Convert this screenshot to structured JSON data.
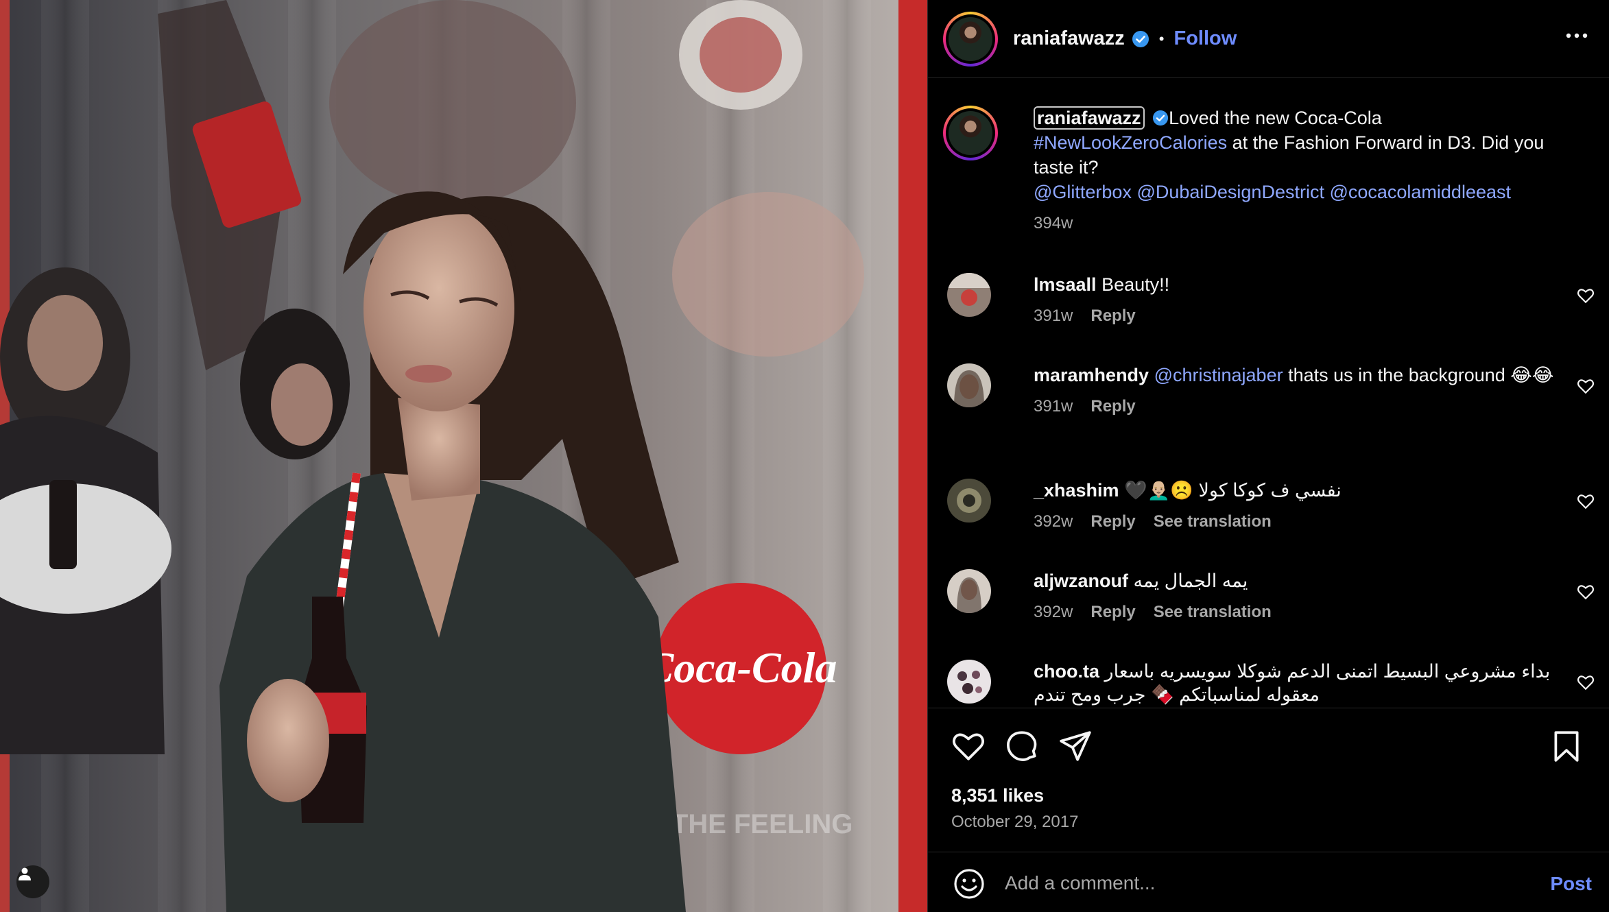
{
  "post": {
    "username": "raniafawazz",
    "follow_label": "Follow",
    "separator": "•"
  },
  "caption": {
    "username": "raniafawazz",
    "text_1": "Loved the new Coca-Cola",
    "hashtag": "#NewLookZeroCalories",
    "text_2": " at the Fashion Forward in D3. Did you taste it?",
    "mentions": "@Glitterbox @DubaiDesignDestrict @cocacolamiddleeast",
    "age": "394w"
  },
  "photo": {
    "logo_text": "Coca-Cola",
    "banner_text": "TE THE FEELING"
  },
  "comments": [
    {
      "user": "lmsaall",
      "text": "Beauty!!",
      "age": "391w",
      "reply": "Reply",
      "translate": ""
    },
    {
      "user": "maramhendy",
      "mention": "@christinajaber",
      "text": " thats us in the background 😂😂",
      "age": "391w",
      "reply": "Reply",
      "translate": ""
    },
    {
      "user": "_xhashim",
      "text": "🖤👨🏼‍🦲☹️ نفسي ف كوكا كولا",
      "age": "392w",
      "reply": "Reply",
      "translate": "See translation"
    },
    {
      "user": "aljwzanouf",
      "text": "يمه الجمال يمه",
      "age": "392w",
      "reply": "Reply",
      "translate": "See translation"
    },
    {
      "user": "choo.ta",
      "text": "بداء مشروعي البسيط اتمنى الدعم شوكلا سويسريه باسعار معقوله لمناسباتكم 🍫 جرب ومح تندم",
      "age": "",
      "reply": "",
      "translate": ""
    }
  ],
  "stats": {
    "likes": "8,351 likes",
    "date": "October 29, 2017"
  },
  "composer": {
    "placeholder": "Add a comment...",
    "post_label": "Post"
  },
  "colors": {
    "accent": "#6e8cff",
    "link": "#8fa8ff",
    "muted": "#a8a8a8",
    "coca_red": "#d1242a"
  },
  "icons": [
    "verified-badge-icon",
    "more-options-icon",
    "heart-icon",
    "comment-icon",
    "share-icon",
    "bookmark-icon",
    "emoji-icon",
    "user-tag-icon"
  ]
}
